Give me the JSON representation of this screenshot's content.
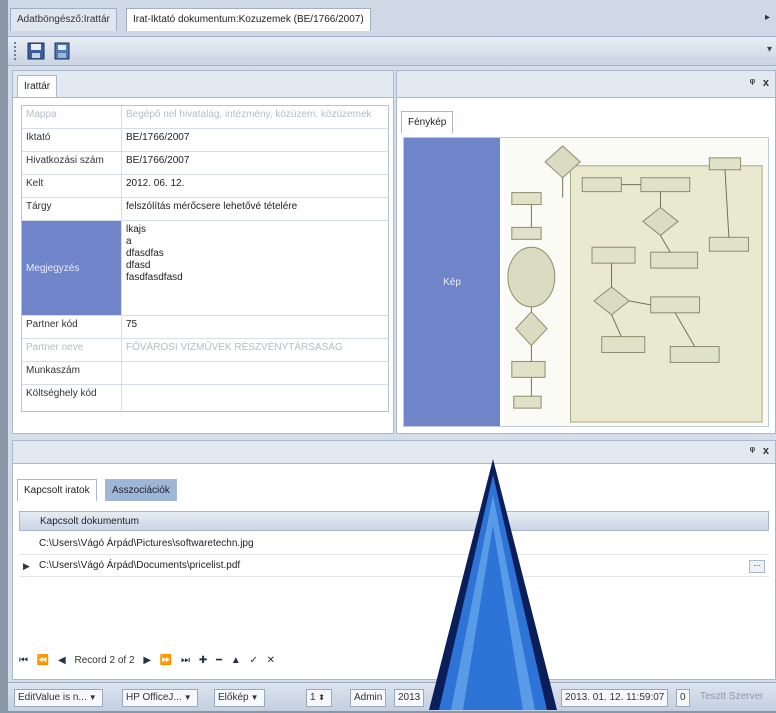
{
  "doc_tabs": [
    {
      "label": "Adatböngésző:Irattár",
      "active": false
    },
    {
      "label": "Irat-Iktató dokumentum:Kozuzemek (BE/1766/2007)",
      "active": true
    }
  ],
  "doc_tab_scroll": "▸",
  "toolbar": {
    "menu_arrow": "▾"
  },
  "left_pane": {
    "tab": "Irattár",
    "rows": [
      {
        "label": "Mappa",
        "value": "Begépő nel hivatalág, intézmény, közüzem, közüzemek",
        "style": "dim"
      },
      {
        "label": "Iktató",
        "value": "BE/1766/2007",
        "style": ""
      },
      {
        "label": "Hivatkozási szám",
        "value": "BE/1766/2007",
        "style": ""
      },
      {
        "label": "Kelt",
        "value": "2012. 06. 12.",
        "style": ""
      },
      {
        "label": "Tárgy",
        "value": "felszólítás mérőcsere lehetővé tételére",
        "style": ""
      },
      {
        "label": "Megjegyzés",
        "lines": [
          "lkajs",
          "a",
          "dfasdfas",
          "dfasd",
          "fasdfasdfasd"
        ],
        "style": "hl"
      },
      {
        "label": "Partner kód",
        "value": "75",
        "style": ""
      },
      {
        "label": "Partner neve",
        "value": "FŐVÁROSI VÍZMŰVEK RÉSZVÉNYTÁRSASÁG",
        "style": "dim"
      },
      {
        "label": "Munkaszám",
        "value": "",
        "style": ""
      },
      {
        "label": "Költséghely kód",
        "value": "",
        "style": ""
      }
    ]
  },
  "right_pane": {
    "tab": "Fénykép",
    "image_label": "Kép",
    "pin": "ᵠ",
    "close": "x"
  },
  "bottom_pane": {
    "tabs": [
      "Kapcsolt iratok",
      "Asszociációk"
    ],
    "column_header": "Kapcsolt dokumentum",
    "rows": [
      {
        "indicator": "",
        "path": "C:\\Users\\Vágó Árpád\\Pictures\\softwaretechn.jpg"
      },
      {
        "indicator": "▶",
        "path": "C:\\Users\\Vágó Árpád\\Documents\\pricelist.pdf"
      }
    ],
    "more_button": "···",
    "nav_buttons": [
      "⏮",
      "⏪",
      "◀"
    ],
    "record_text": "Record 2 of 2",
    "nav_buttons_after": [
      "▶",
      "⏩",
      "⏭",
      "✚",
      "━",
      "▲",
      "✓",
      "✕"
    ]
  },
  "status_bar": {
    "editvalue": "EditValue is n...",
    "printer": "HP OfficeJ...",
    "preview": "Előkép",
    "copies": "1",
    "user": "Admin",
    "year": "2013",
    "datetime": "2013. 01. 12. 11:59:07",
    "count": "0",
    "right_text": "Tesztt Szerver"
  },
  "colors": {
    "accent": "#6f84c9",
    "arrow_fill": "#2e74d6",
    "arrow_outline": "#0a1f5a"
  }
}
